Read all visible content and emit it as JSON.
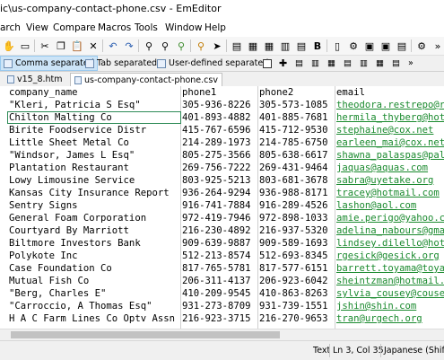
{
  "window": {
    "title": "ic\\us-company-contact-phone.csv - EmEditor"
  },
  "menu": [
    "arch",
    "View",
    "Compare",
    "Macros",
    "Tools",
    "Window",
    "Help"
  ],
  "csv_modes": [
    "Comma separated",
    "Tab separated",
    "User-defined separated"
  ],
  "tabs": [
    "v15_8.htm",
    "us-company-contact-phone.csv"
  ],
  "headers": [
    "company_name",
    "phone1",
    "phone2",
    "email"
  ],
  "rows": [
    [
      "\"Kleri, Patricia S Esq\"",
      "305-936-8226",
      "305-573-1085",
      "theodora.restrepo@re"
    ],
    [
      "Chilton Malting Co",
      "401-893-4882",
      "401-885-7681",
      "hermila_thyberg@hotm"
    ],
    [
      "Birite Foodservice Distr",
      "415-767-6596",
      "415-712-9530",
      "stephaine@cox.net"
    ],
    [
      "Little Sheet Metal Co",
      "214-289-1973",
      "214-785-6750",
      "earleen_mai@cox.net"
    ],
    [
      "\"Windsor, James L Esq\"",
      "805-275-3566",
      "805-638-6617",
      "shawna_palaspas@palas"
    ],
    [
      "Plantation Restaurant",
      "269-756-7222",
      "269-431-9464",
      "jaquas@aquas.com"
    ],
    [
      "Lowy Limousine Service",
      "803-925-5213",
      "803-681-3678",
      "sabra@uyetake.org"
    ],
    [
      "Kansas City Insurance Report",
      "936-264-9294",
      "936-988-8171",
      "tracey@hotmail.com"
    ],
    [
      "Sentry Signs",
      "916-741-7884",
      "916-289-4526",
      "lashon@aol.com"
    ],
    [
      "General Foam Corporation",
      "972-419-7946",
      "972-898-1033",
      "amie.perigo@yahoo.co"
    ],
    [
      "Courtyard By Marriott",
      "216-230-4892",
      "216-937-5320",
      "adelina_nabours@gmai"
    ],
    [
      "Biltmore Investors Bank",
      "909-639-9887",
      "909-589-1693",
      "lindsey.dilello@hotm"
    ],
    [
      "Polykote Inc",
      "512-213-8574",
      "512-693-8345",
      "rgesick@gesick.org"
    ],
    [
      "Case Foundation Co",
      "817-765-5781",
      "817-577-6151",
      "barrett.toyama@toyam"
    ],
    [
      "Mutual Fish Co",
      "206-311-4137",
      "206-923-6042",
      "sheintzman@hotmail.c"
    ],
    [
      "\"Berg, Charles E\"",
      "410-209-9545",
      "410-863-8263",
      "sylvia_cousey@cousex"
    ],
    [
      "\"Carroccio, A Thomas Esq\"",
      "931-273-8709",
      "931-739-1551",
      "jshin@shin.com"
    ],
    [
      "H A C Farm Lines Co Optv Assn",
      "216-923-3715",
      "216-270-9653",
      "tran@urgech.org"
    ]
  ],
  "status": {
    "mode": "Text",
    "position": "Ln 3, Col 35",
    "encoding": "Japanese (Shift-JI"
  },
  "colors": {
    "link": "#1a8a2e",
    "cursor_box": "#2e8b57",
    "active_mode": "#cce4f7"
  }
}
